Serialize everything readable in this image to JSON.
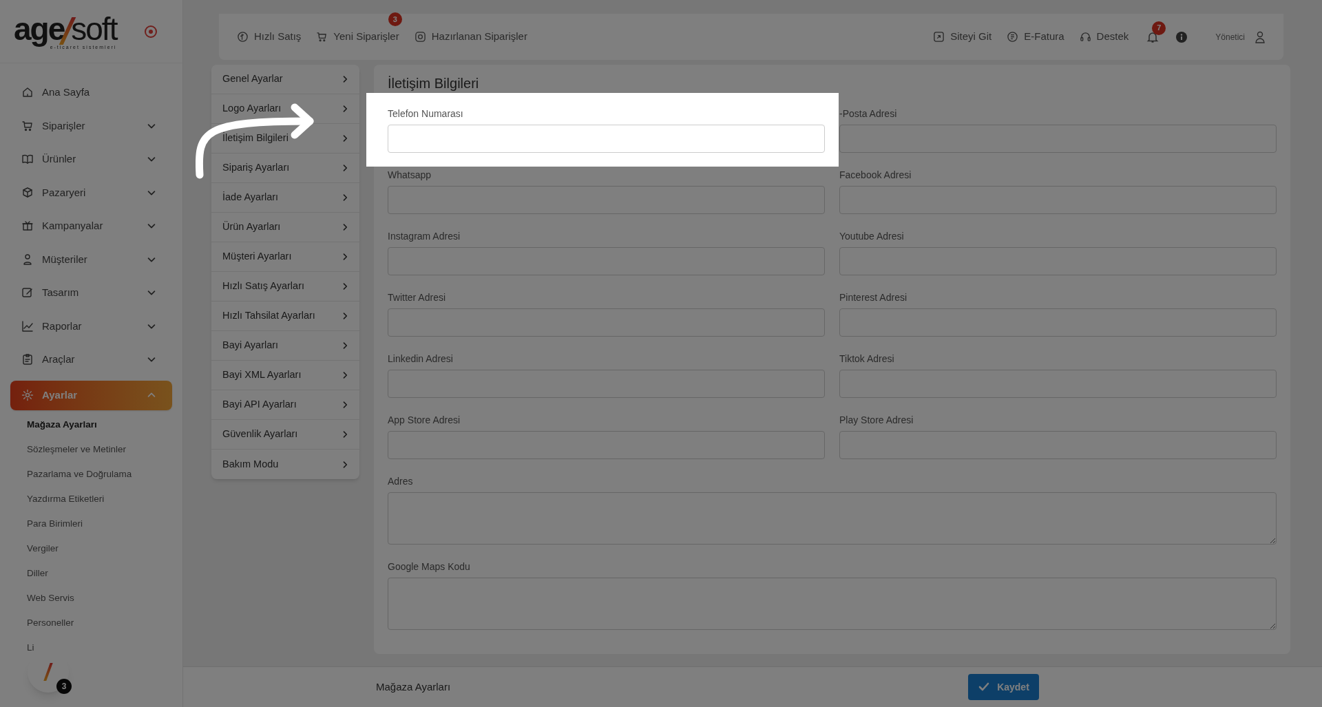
{
  "logo": {
    "word_left": "age",
    "word_right": "soft",
    "tagline": "e-ticaret sistemleri"
  },
  "sidebar": {
    "items": [
      {
        "label": "Ana Sayfa",
        "selected": false
      },
      {
        "label": "Siparişler",
        "selected": false,
        "expanded": false
      },
      {
        "label": "Ürünler",
        "selected": false,
        "expanded": false
      },
      {
        "label": "Pazaryeri",
        "selected": false,
        "expanded": false
      },
      {
        "label": "Kampanyalar",
        "selected": false,
        "expanded": false
      },
      {
        "label": "Müşteriler",
        "selected": false,
        "expanded": false
      },
      {
        "label": "Tasarım",
        "selected": false,
        "expanded": false
      },
      {
        "label": "Raporlar",
        "selected": false,
        "expanded": false
      },
      {
        "label": "Araçlar",
        "selected": false,
        "expanded": false
      },
      {
        "label": "Ayarlar",
        "selected": true,
        "expanded": true,
        "children": [
          {
            "label": "Mağaza Ayarları",
            "selected": true
          },
          {
            "label": "Sözleşmeler ve Metinler",
            "selected": false
          },
          {
            "label": "Pazarlama ve Doğrulama",
            "selected": false
          },
          {
            "label": "Yazdırma Etiketleri",
            "selected": false
          },
          {
            "label": "Para Birimleri",
            "selected": false
          },
          {
            "label": "Vergiler",
            "selected": false
          },
          {
            "label": "Diller",
            "selected": false
          },
          {
            "label": "Web Servis",
            "selected": false
          },
          {
            "label": "Personeller",
            "selected": false
          },
          {
            "label": "Li",
            "selected": false
          }
        ]
      }
    ]
  },
  "widget_badge": "3",
  "topbar": {
    "left": [
      {
        "label": "Hızlı Satış"
      },
      {
        "label": "Yeni Siparişler",
        "badge": "3"
      },
      {
        "label": "Hazırlanan Siparişler"
      }
    ],
    "right": [
      {
        "label": "Siteyi Git"
      },
      {
        "label": "E-Fatura"
      },
      {
        "label": "Destek"
      }
    ],
    "notification_badge": "7",
    "user": "Yönetici"
  },
  "settings_menu": [
    "Genel Ayarlar",
    "Logo Ayarları",
    "İletişim Bilgileri",
    "Sipariş Ayarları",
    "İade Ayarları",
    "Ürün Ayarları",
    "Müşteri Ayarları",
    "Hızlı Satış Ayarları",
    "Hızlı Tahsilat Ayarları",
    "Bayi Ayarları",
    "Bayi XML Ayarları",
    "Bayi API Ayarları",
    "Güvenlik Ayarları",
    "Bakım Modu"
  ],
  "form": {
    "title": "İletişim Bilgileri",
    "fields": [
      {
        "label": "Telefon Numarası",
        "kind": "input",
        "highlighted": true
      },
      {
        "label": "-Posta Adresi",
        "kind": "input",
        "highlighted": false
      },
      {
        "label": "Whatsapp",
        "kind": "input",
        "highlighted": false
      },
      {
        "label": "Facebook Adresi",
        "kind": "input",
        "highlighted": false
      },
      {
        "label": "Instagram Adresi",
        "kind": "input",
        "highlighted": false
      },
      {
        "label": "Youtube Adresi",
        "kind": "input",
        "highlighted": false
      },
      {
        "label": "Twitter Adresi",
        "kind": "input",
        "highlighted": false
      },
      {
        "label": "Pinterest Adresi",
        "kind": "input",
        "highlighted": false
      },
      {
        "label": "Linkedin Adresi",
        "kind": "input",
        "highlighted": false
      },
      {
        "label": "Tiktok Adresi",
        "kind": "input",
        "highlighted": false
      },
      {
        "label": "App Store Adresi",
        "kind": "input",
        "highlighted": false
      },
      {
        "label": "Play Store Adresi",
        "kind": "input",
        "highlighted": false
      },
      {
        "label": "Adres",
        "kind": "textarea",
        "highlighted": false
      },
      {
        "label": "Google Maps Kodu",
        "kind": "textarea",
        "highlighted": false
      }
    ]
  },
  "footer": {
    "breadcrumb": "Mağaza Ayarları",
    "save_button": "Kaydet"
  }
}
